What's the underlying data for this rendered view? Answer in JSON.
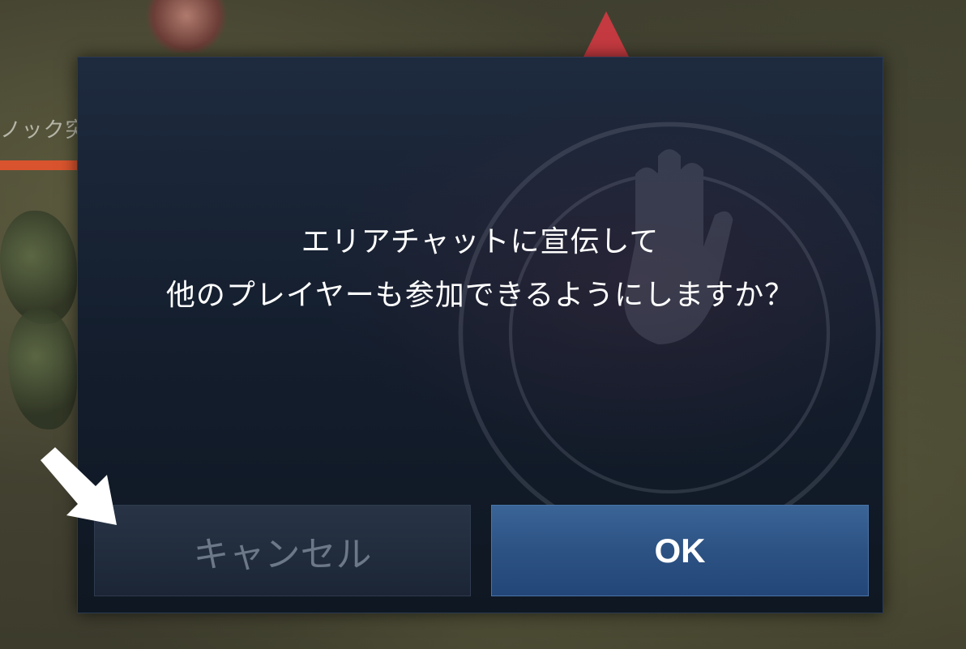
{
  "background": {
    "enemy_name": "ノック突撃兵",
    "enemy_hp_fraction": 0.8
  },
  "dialog": {
    "message_line1": "エリアチャットに宣伝して",
    "message_line2": "他のプレイヤーも参加できるようにしますか？",
    "cancel_label": "キャンセル",
    "ok_label": "OK"
  },
  "colors": {
    "dialog_bg": "#162131",
    "ok_button": "#2c5283",
    "cancel_button": "#222d3e",
    "cancel_text": "#6c7788",
    "hp_bar": "#d9542e",
    "arrow": "#ffffff"
  },
  "icons": {
    "pointer_arrow": "pointer-arrow-icon",
    "watermark": "hand-emblem-icon"
  }
}
